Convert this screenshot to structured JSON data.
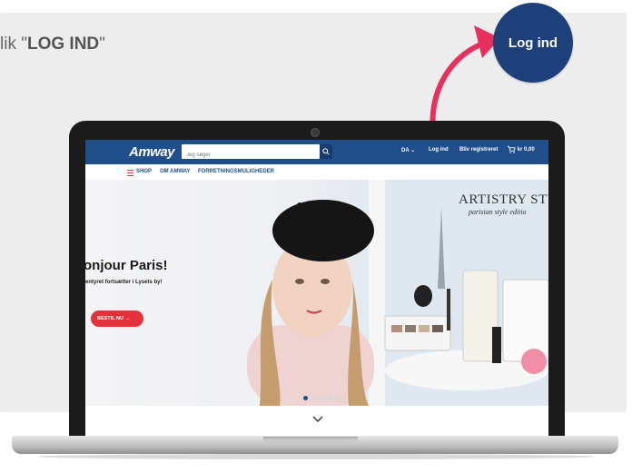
{
  "instruction": {
    "prefix": "lik \"",
    "bold": "LOG IND",
    "suffix": "\""
  },
  "callout": {
    "label": "Log ind"
  },
  "colors": {
    "brand_blue": "#1f4e8b",
    "accent_red": "#e4323c",
    "arrow": "#e8305c"
  },
  "site": {
    "logo": "Amway",
    "search_placeholder": "Jeg søger",
    "language": "DA",
    "login": "Log ind",
    "register": "Bliv registreret",
    "cart": "kr 0,00",
    "menu": [
      "SHOP",
      "OM AMWAY",
      "FORRETNINGSMULIGHEDER"
    ]
  },
  "hero": {
    "title": "onjour Paris!",
    "subtitle": "entyret fortsætter i Lysets by!",
    "cta": "BESTIL NU →",
    "brand": "ARTISTRY STU",
    "brand_sub": "parisian style editio",
    "slide_count": 5,
    "active_slide": 1
  }
}
